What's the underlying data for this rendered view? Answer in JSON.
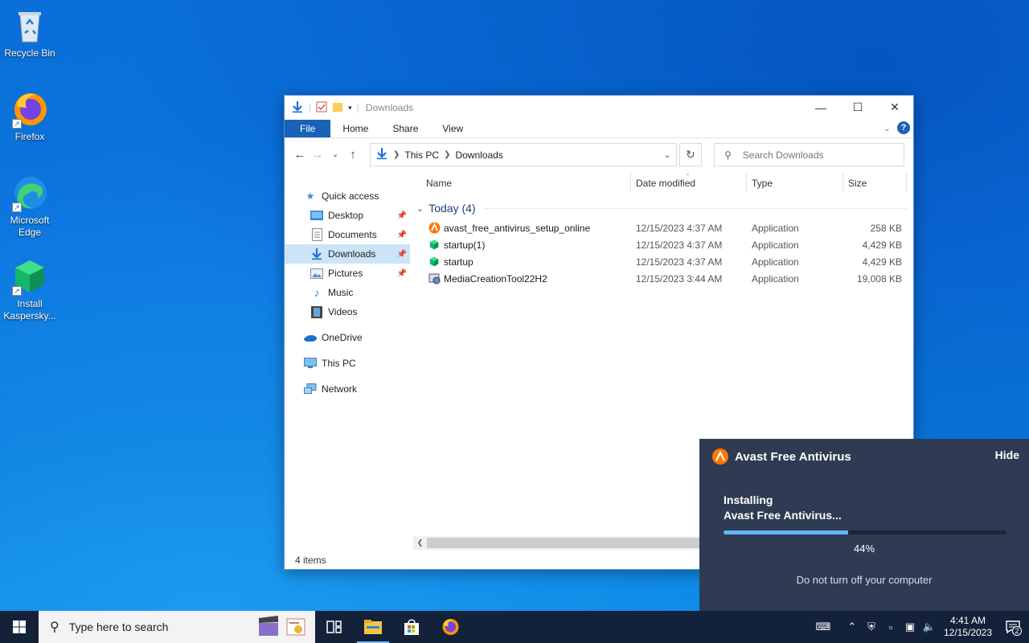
{
  "desktop": {
    "icons": [
      {
        "label": "Recycle Bin",
        "icon": "recycle-bin-icon"
      },
      {
        "label": "Firefox",
        "icon": "firefox-icon"
      },
      {
        "label": "Microsoft Edge",
        "icon": "edge-icon"
      },
      {
        "label": "Install Kaspersky...",
        "icon": "kaspersky-installer-icon"
      }
    ]
  },
  "explorer": {
    "title": "Downloads",
    "ribbon_tabs": [
      "File",
      "Home",
      "Share",
      "View"
    ],
    "address": {
      "crumbs": [
        "This PC",
        "Downloads"
      ]
    },
    "search_placeholder": "Search Downloads",
    "nav": [
      {
        "label": "Quick access",
        "icon": "star-icon"
      },
      {
        "label": "Desktop",
        "icon": "desktop-folder-icon"
      },
      {
        "label": "Documents",
        "icon": "documents-folder-icon"
      },
      {
        "label": "Downloads",
        "icon": "downloads-folder-icon"
      },
      {
        "label": "Pictures",
        "icon": "pictures-folder-icon"
      },
      {
        "label": "Music",
        "icon": "music-folder-icon"
      },
      {
        "label": "Videos",
        "icon": "videos-folder-icon"
      },
      {
        "label": "OneDrive",
        "icon": "onedrive-icon"
      },
      {
        "label": "This PC",
        "icon": "this-pc-icon"
      },
      {
        "label": "Network",
        "icon": "network-icon"
      }
    ],
    "columns": [
      "Name",
      "Date modified",
      "Type",
      "Size"
    ],
    "group_label": "Today (4)",
    "files": [
      {
        "name": "avast_free_antivirus_setup_online",
        "date": "12/15/2023 4:37 AM",
        "type": "Application",
        "size": "258 KB",
        "icon": "avast-icon"
      },
      {
        "name": "startup(1)",
        "date": "12/15/2023 4:37 AM",
        "type": "Application",
        "size": "4,429 KB",
        "icon": "green-cube-icon"
      },
      {
        "name": "startup",
        "date": "12/15/2023 4:37 AM",
        "type": "Application",
        "size": "4,429 KB",
        "icon": "green-cube-icon"
      },
      {
        "name": "MediaCreationTool22H2",
        "date": "12/15/2023 3:44 AM",
        "type": "Application",
        "size": "19,008 KB",
        "icon": "media-creation-tool-icon"
      }
    ],
    "status": "4 items"
  },
  "avast": {
    "title": "Avast Free Antivirus",
    "hide_label": "Hide",
    "line1": "Installing",
    "line2": "Avast Free Antivirus...",
    "progress": 0.44,
    "progress_label": "44%",
    "note": "Do not turn off your computer",
    "accent": "#ff7800"
  },
  "taskbar": {
    "search_placeholder": "Type here to search",
    "time": "4:41 AM",
    "date": "12/15/2023",
    "notification_count": "2"
  }
}
